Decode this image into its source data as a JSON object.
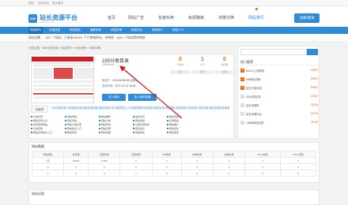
{
  "topbar": {
    "links": [
      "您好",
      "站长资讯",
      "设为首页"
    ]
  },
  "header": {
    "logo_icon": "365",
    "logo_title": "站长资源平台",
    "logo_sub": "www.zzwm.com",
    "nav": [
      "首页",
      "网站广告",
      "友链买卖",
      "免费赚链",
      "流量交换",
      "网站排行"
    ],
    "login": "注册/登录"
  },
  "tabbar": {
    "tabs": [
      "网站排行",
      "分类目录",
      "网站提交",
      "最新收录",
      "网站快审",
      "网站评论",
      "网站排行",
      "网站人气"
    ]
  },
  "stats": {
    "prefix": "网站总数：",
    "total": "139",
    "t1": "个网站，已收录",
    "recorded": "40429",
    "t2": "个已审核网站，待审核",
    "pending": "1824",
    "t3": "个网站等待审核"
  },
  "breadcrumb": "当前位置：365分类目录 » 网站排行 » 综合其他 » 网站详情",
  "site": {
    "title": "235分类目录",
    "url": "235fl.com",
    "fields": [
      {
        "label": "网站IP：",
        "value": "123.206.55.96 (北京)"
      },
      {
        "label": "收录时间：",
        "value": "2017-12-21 15:04"
      }
    ],
    "buttons": [
      "进入网站",
      "加入我的收藏"
    ],
    "stats": [
      {
        "value": "0",
        "label": "今日IP"
      },
      {
        "value": "1",
        "label": "人气"
      },
      {
        "value": "0",
        "label": "访问量"
      }
    ],
    "badges": [
      "访客",
      "排名",
      "出站"
    ]
  },
  "keywords": {
    "label": "关键词",
    "desc": "235分类目录,235网站目录,免费收录网站,网站目录大全,网站提交入口,网站导航,网站收录,网站目录,网址导航,综合网站分类目录,分类目录,网站目录免费收录",
    "items": [
      "分类目录",
      "网站目录大全",
      "免费收录网站",
      "分类目录",
      "网站目录提交入口",
      "网站导航",
      "网址导航",
      "网站分类目录",
      "网站提交入口",
      "网站目录",
      "网站推荐",
      "网站分类",
      "网站导航",
      "网站目录",
      "网站地图",
      "站长资讯",
      "网站收录",
      "分类目录免费",
      "网址提交",
      "网站排名",
      "网站导航",
      "目录网站",
      "网站推广",
      "网站优化",
      "网站收录"
    ]
  },
  "sidebar": {
    "search_placeholder": "",
    "title": "热门推荐",
    "items": [
      {
        "rank": "1",
        "name": "fan121上网导航",
        "score": "99999"
      },
      {
        "rank": "2",
        "name": "365网址导航",
        "score": "99999"
      },
      {
        "rank": "3",
        "name": "站长分类目录",
        "score": "99999"
      },
      {
        "rank": "4",
        "name": "300分类目录",
        "score": "29136"
      },
      {
        "rank": "5",
        "name": "站长资源网",
        "score": "29136"
      },
      {
        "rank": "6",
        "name": "站长资源平台",
        "score": "29136"
      },
      {
        "rank": "7",
        "name": "14688网站目录",
        "score": "29136"
      }
    ]
  },
  "traffic": {
    "title": "网站数据",
    "headers": [
      "网站排名",
      "收录量",
      "百度权重",
      "百度收录",
      "360收录",
      "搜狗收录",
      "谷歌收录",
      "Alexa排名",
      "Alexa流量"
    ],
    "rows": [
      [
        "1天",
        "26269",
        "17900",
        "0",
        "0",
        "0",
        "0",
        "0",
        "0"
      ],
      [
        "0",
        "0",
        "0",
        "0",
        "0",
        "0",
        "0",
        "0",
        "0"
      ],
      [
        "0",
        "0",
        "0",
        "0",
        "0",
        "0",
        "0",
        "0",
        "0"
      ]
    ]
  },
  "growth": {
    "title": "成长历程"
  }
}
